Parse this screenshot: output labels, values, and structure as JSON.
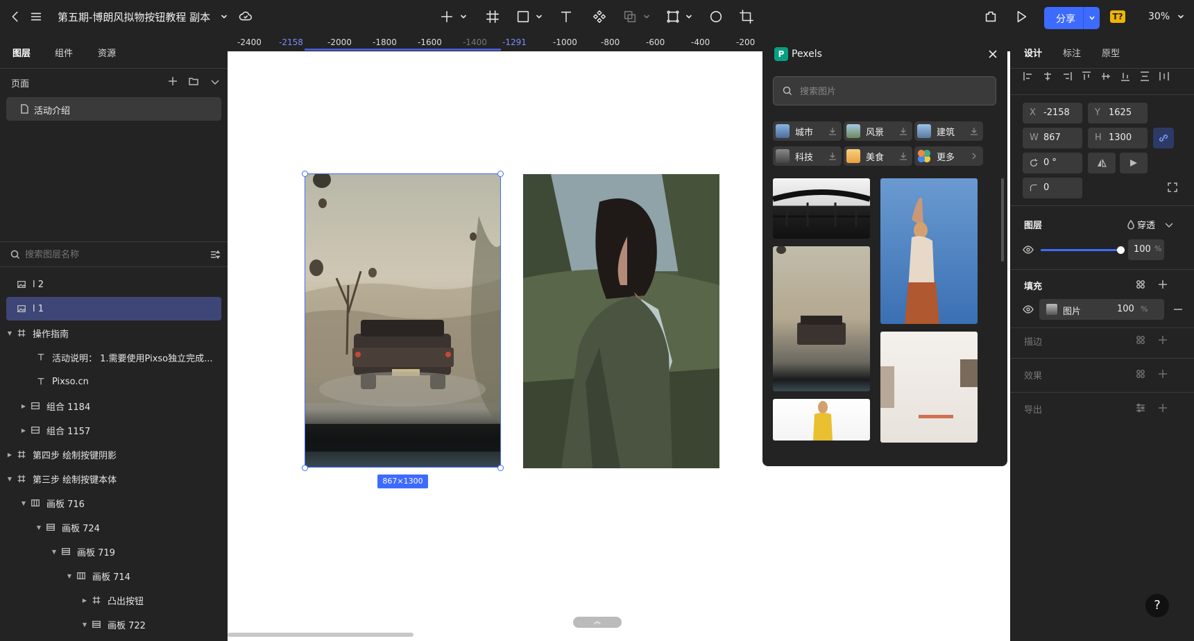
{
  "top": {
    "title": "第五期-博朗风拟物按钮教程 副本",
    "share_label": "分享",
    "badge": "T?",
    "zoom": "30%"
  },
  "left": {
    "tabs": [
      "图层",
      "组件",
      "资源"
    ],
    "pages_label": "页面",
    "page_item": "活动介绍",
    "search_placeholder": "搜索图层名称",
    "layers": [
      {
        "label": "l 2"
      },
      {
        "label": "l 1"
      },
      {
        "label": "操作指南"
      },
      {
        "label": "活动说明：  1.需要使用Pixso独立完成..."
      },
      {
        "label": "Pixso.cn"
      },
      {
        "label": "组合 1184"
      },
      {
        "label": "组合 1157"
      },
      {
        "label": "第四步 绘制按键阴影"
      },
      {
        "label": "第三步 绘制按键本体"
      },
      {
        "label": "画板 716"
      },
      {
        "label": "画板 724"
      },
      {
        "label": "画板 719"
      },
      {
        "label": "画板 714"
      },
      {
        "label": "凸出按钮"
      },
      {
        "label": "画板 722"
      }
    ]
  },
  "ruler": {
    "ticks": [
      "-2400",
      "-2158",
      "-2000",
      "-1800",
      "-1600",
      "-1400",
      "-1291",
      "-1000",
      "-800",
      "-600",
      "-400",
      "-200"
    ]
  },
  "canvas": {
    "size_badge": "867×1300",
    "collapse_glyph": "︽"
  },
  "pexels": {
    "title": "Pexels",
    "search_placeholder": "搜索图片",
    "categories": [
      "城市",
      "风景",
      "建筑",
      "科技",
      "美食",
      "更多"
    ]
  },
  "right": {
    "tabs": [
      "设计",
      "标注",
      "原型"
    ],
    "x_label": "X",
    "x_value": "-2158",
    "y_label": "Y",
    "y_value": "1625",
    "w_label": "W",
    "w_value": "867",
    "h_label": "H",
    "h_value": "1300",
    "rotation": "0 °",
    "radius": "0",
    "layer_section": "图层",
    "blend_mode": "穿透",
    "opacity": "100",
    "opacity_unit": "%",
    "opacity_level": 100,
    "fill_section": "填充",
    "fill_type": "图片",
    "fill_opacity": "100",
    "fill_unit": "%",
    "stroke_section": "描边",
    "effect_section": "效果",
    "export_section": "导出"
  },
  "help": "?"
}
